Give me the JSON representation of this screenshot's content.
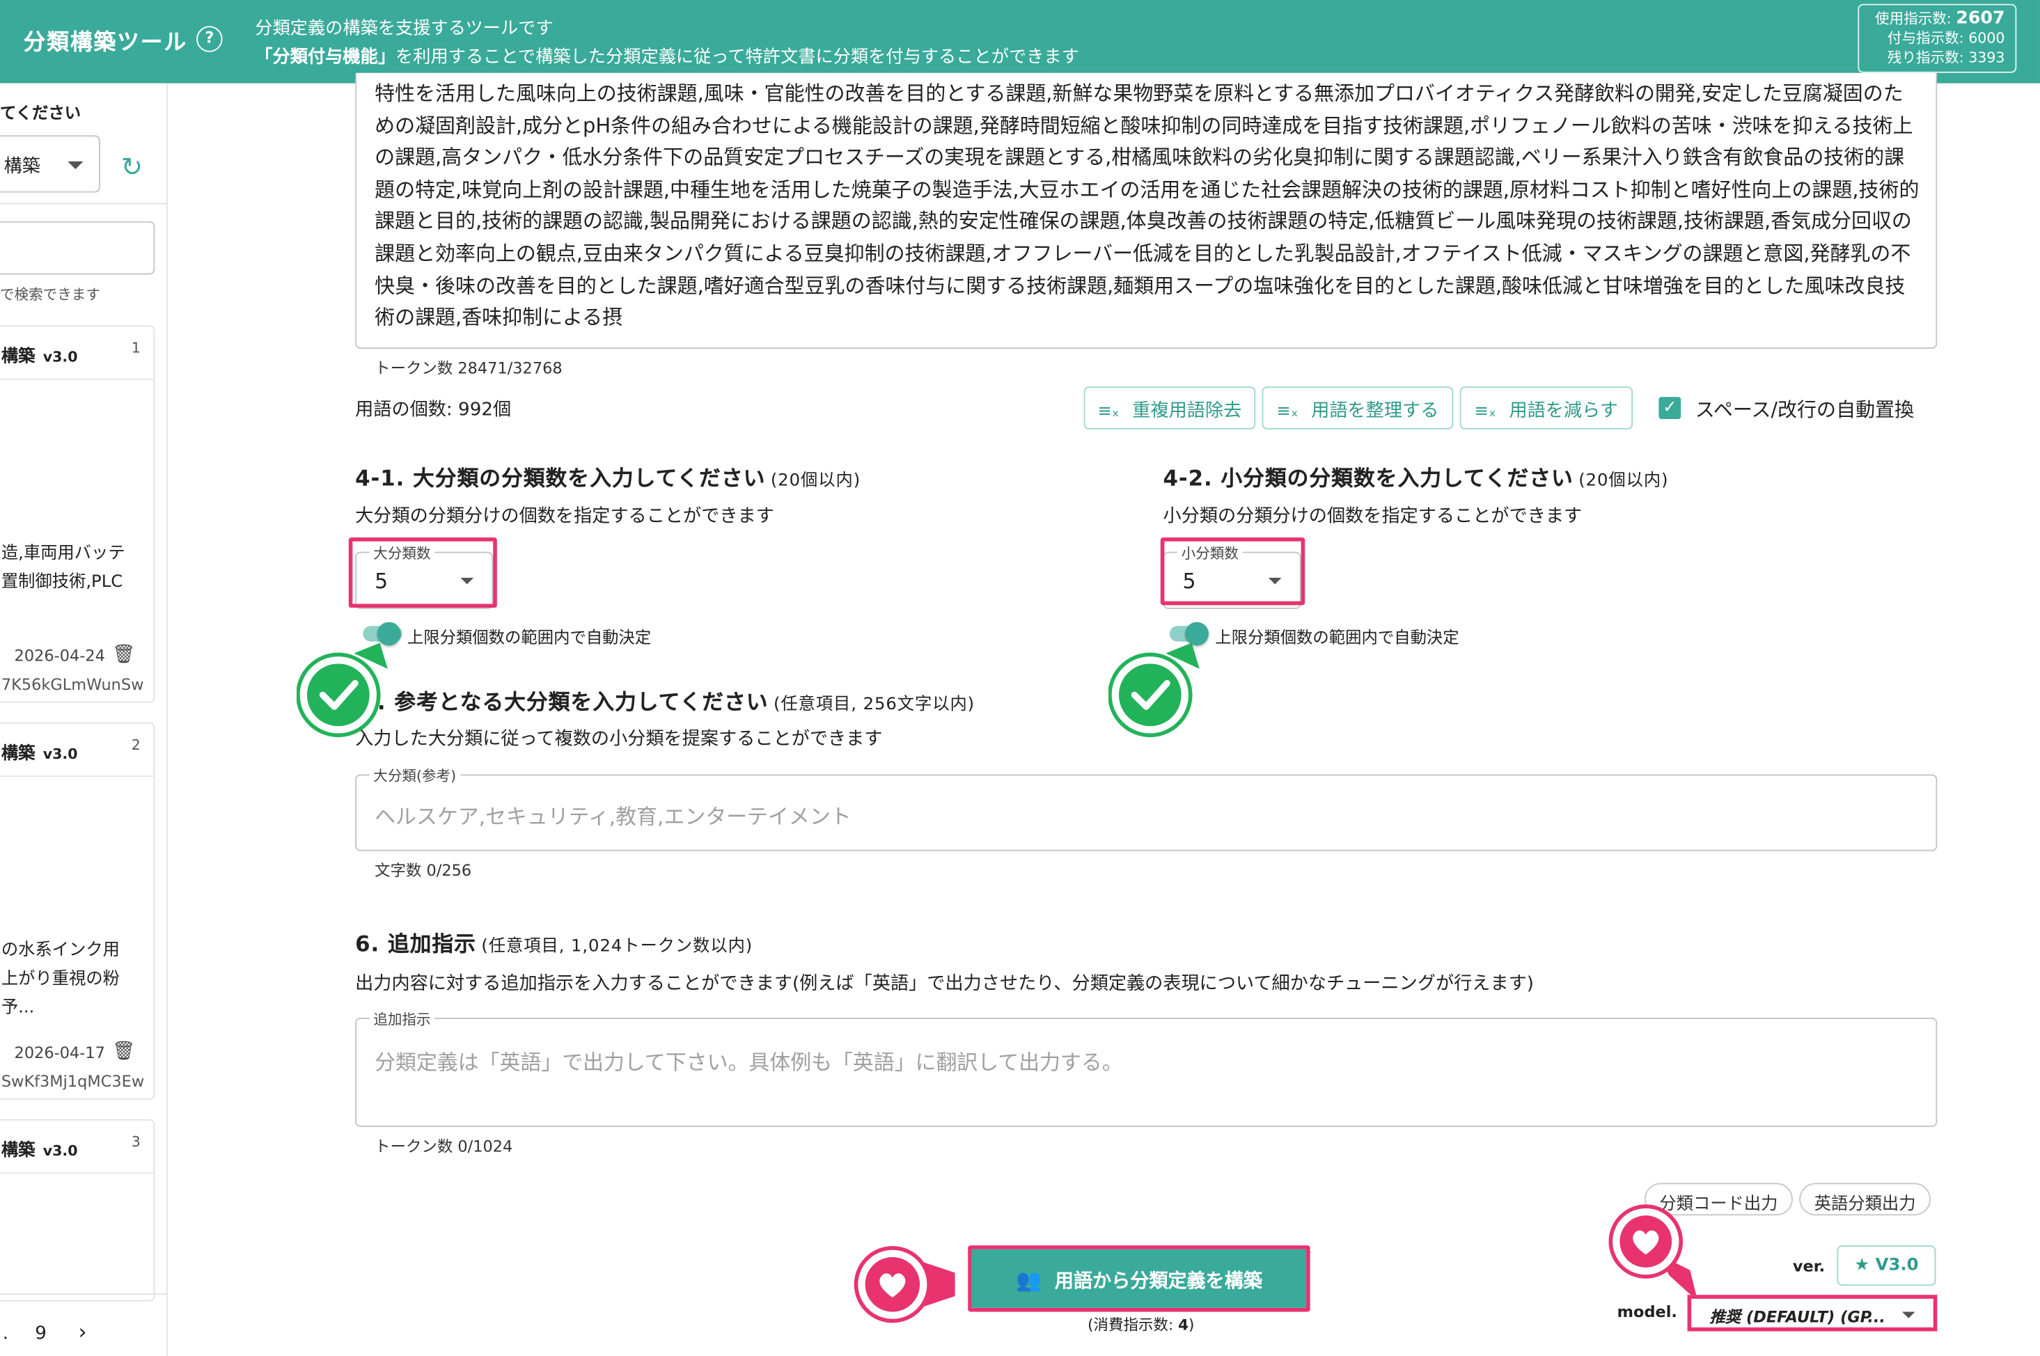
{
  "header": {
    "app_title": "分類構築ツール",
    "help_icon": "question-circle-icon",
    "desc_line1": "分類定義の構築を支援するツールです",
    "desc_line2_bold": "「分類付与機能」",
    "desc_line2_rest": "を利用することで構築した分類定義に従って特許文書に分類を付与することができます",
    "usage": {
      "used_label": "使用指示数:",
      "used_value": "2607",
      "granted_label": "付与指示数:",
      "granted_value": "6000",
      "remaining_label": "残り指示数:",
      "remaining_value": "3393"
    }
  },
  "sidebar": {
    "heading": "てください",
    "select_value": "構築",
    "search_hint": "で検索できます",
    "cards": [
      {
        "title": "構築",
        "version": "v3.0",
        "num": "1",
        "text1": "造,車両用バッテ",
        "text2": "置制御技術,PLC",
        "date": "2026-04-24",
        "id": "7K56kGLmWunSw"
      },
      {
        "title": "構築",
        "version": "v3.0",
        "num": "2",
        "text1": "の水系インク用",
        "text2": "上がり重視の粉",
        "text3": "予...",
        "date": "2026-04-17",
        "id": "SwKf3Mj1qMC3Ew"
      },
      {
        "title": "構築",
        "version": "v3.0",
        "num": "3"
      }
    ],
    "pager": {
      "dots": ".",
      "page": "9",
      "next": "›"
    }
  },
  "terms": {
    "text": "特性を活用した風味向上の技術課題,風味・官能性の改善を目的とする課題,新鮮な果物野菜を原料とする無添加プロバイオティクス発酵飲料の開発,安定した豆腐凝固のための凝固剤設計,成分とpH条件の組み合わせによる機能設計の課題,発酵時間短縮と酸味抑制の同時達成を目指す技術課題,ポリフェノール飲料の苦味・渋味を抑える技術上の課題,高タンパク・低水分条件下の品質安定プロセスチーズの実現を課題とする,柑橘風味飲料の劣化臭抑制に関する課題認識,ベリー系果汁入り鉄含有飲食品の技術的課題の特定,味覚向上剤の設計課題,中種生地を活用した焼菓子の製造手法,大豆ホエイの活用を通じた社会課題解決の技術的課題,原材料コスト抑制と嗜好性向上の課題,技術的課題と目的,技術的課題の認識,製品開発における課題の認識,熱的安定性確保の課題,体臭改善の技術課題の特定,低糖質ビール風味発現の技術課題,技術課題,香気成分回収の課題と効率向上の観点,豆由来タンパク質による豆臭抑制の技術課題,オフフレーバー低減を目的とした乳製品設計,オフテイスト低減・マスキングの課題と意図,発酵乳の不快臭・後味の改善を目的とした課題,嗜好適合型豆乳の香味付与に関する技術課題,麺類用スープの塩味強化を目的とした課題,酸味低減と甘味増強を目的とした風味改良技術の課題,香味抑制による摂",
    "token_count": "トークン数 28471/32768",
    "term_count": "用語の個数: 992個",
    "buttons": {
      "dedupe": "重複用語除去",
      "organize": "用語を整理する",
      "reduce": "用語を減らす"
    },
    "auto_replace_label": "スペース/改行の自動置換"
  },
  "section41": {
    "title": "4-1. 大分類の分類数を入力してください",
    "sub": "(20個以内)",
    "desc": "大分類の分類分けの個数を指定することができます",
    "field_label": "大分類数",
    "value": "5",
    "toggle_label": "上限分類個数の範囲内で自動決定"
  },
  "section42": {
    "title": "4-2. 小分類の分類数を入力してください",
    "sub": "(20個以内)",
    "desc": "小分類の分類分けの個数を指定することができます",
    "field_label": "小分類数",
    "value": "5",
    "toggle_label": "上限分類個数の範囲内で自動決定"
  },
  "section5": {
    "title_prefix": ".",
    "title": "参考となる大分類を入力してください",
    "sub": "(任意項目, 256文字以内)",
    "desc": "入力した大分類に従って複数の小分類を提案することができます",
    "field_label": "大分類(参考)",
    "placeholder": "ヘルスケア,セキュリティ,教育,エンターテイメント",
    "char_count": "文字数 0/256"
  },
  "section6": {
    "title": "6. 追加指示",
    "sub": "(任意項目, 1,024トークン数以内)",
    "desc": "出力内容に対する追加指示を入力することができます(例えば「英語」で出力させたり、分類定義の表現について細かなチューニングが行えます)",
    "field_label": "追加指示",
    "placeholder": "分類定義は「英語」で出力して下さい。具体例も「英語」に翻訳して出力する。",
    "token_count": "トークン数 0/1024"
  },
  "options": {
    "code_output": "分類コード出力",
    "english_output": "英語分類出力"
  },
  "action": {
    "build_label": "用語から分類定義を構築",
    "consume_prefix": "(消費指示数: ",
    "consume_value": "4",
    "consume_suffix": ")"
  },
  "version": {
    "label": "ver.",
    "value": "V3.0"
  },
  "model": {
    "label": "model.",
    "value": "推奨 (DEFAULT) (GP..."
  },
  "colors": {
    "accent": "#3aaa9a",
    "highlight": "#e8336f",
    "check_green": "#22b35a"
  }
}
